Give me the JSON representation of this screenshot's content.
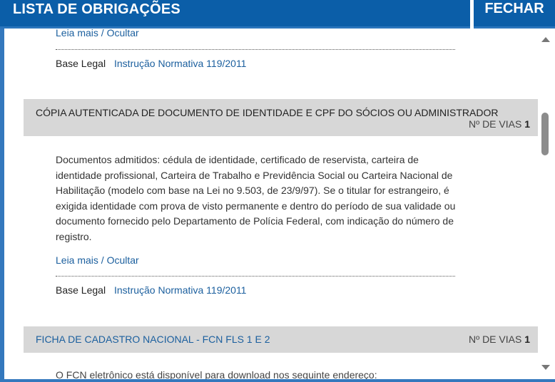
{
  "header": {
    "title": "LISTA DE OBRIGAÇÕES",
    "close_label": "FECHAR"
  },
  "items": [
    {
      "read_more": "Leia mais / Ocultar",
      "base_label": "Base Legal",
      "base_link": "Instrução Normativa 119/2011"
    },
    {
      "title": "CÓPIA AUTENTICADA DE DOCUMENTO DE IDENTIDADE E CPF DO SÓCIOS OU ADMINISTRADOR",
      "vias_label": "Nº DE VIAS",
      "vias_value": "1",
      "description": "Documentos admitidos: cédula de identidade, certificado de reservista, carteira de identidade profissional, Carteira de Trabalho e Previdência Social ou Carteira Nacional de Habilitação (modelo com base na Lei no 9.503, de 23/9/97). Se o titular for estrangeiro, é exigida identidade com prova de visto permanente e dentro do período de sua validade ou documento fornecido pelo Departamento de Polícia Federal, com indicação do número de registro.",
      "read_more": "Leia mais / Ocultar",
      "base_label": "Base Legal",
      "base_link": "Instrução Normativa 119/2011"
    },
    {
      "title": "FICHA DE CADASTRO NACIONAL - FCN FLS 1 E 2",
      "vias_label": "Nº DE VIAS",
      "vias_value": "1",
      "description_preview": "O FCN eletrônico está disponível para download nos seguinte endereço:"
    }
  ],
  "colors": {
    "header_bg": "#0b5ea8",
    "band_bg": "#d7d7d7",
    "link": "#1b5f9e",
    "scroll_thumb": "#8c8c8c"
  }
}
